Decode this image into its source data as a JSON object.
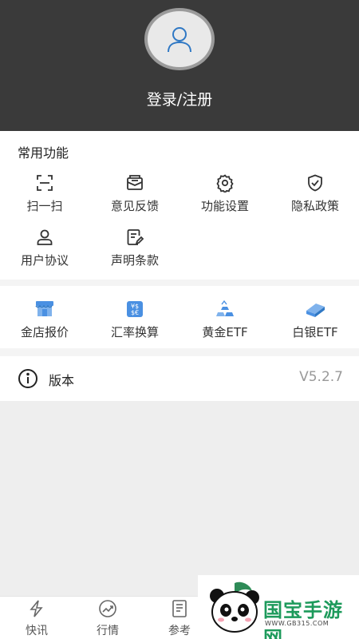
{
  "header": {
    "login_label": "登录/注册"
  },
  "common": {
    "title": "常用功能",
    "items": [
      {
        "label": "扫一扫",
        "icon": "scan-icon"
      },
      {
        "label": "意见反馈",
        "icon": "feedback-icon"
      },
      {
        "label": "功能设置",
        "icon": "gear-icon"
      },
      {
        "label": "隐私政策",
        "icon": "shield-check-icon"
      },
      {
        "label": "用户协议",
        "icon": "user-icon"
      },
      {
        "label": "声明条款",
        "icon": "document-edit-icon"
      }
    ]
  },
  "tools": {
    "items": [
      {
        "label": "金店报价",
        "icon": "gold-store-icon"
      },
      {
        "label": "汇率换算",
        "icon": "exchange-icon"
      },
      {
        "label": "黄金ETF",
        "icon": "gold-bars-icon"
      },
      {
        "label": "白银ETF",
        "icon": "silver-bar-icon"
      }
    ]
  },
  "version": {
    "label": "版本",
    "value": "V5.2.7"
  },
  "tabbar": {
    "items": [
      {
        "label": "快讯",
        "icon": "flash-icon"
      },
      {
        "label": "行情",
        "icon": "trend-icon"
      },
      {
        "label": "参考",
        "icon": "reference-icon"
      }
    ]
  },
  "watermark": {
    "text": "国宝手游网",
    "url": "WWW.GB315.COM"
  },
  "colors": {
    "header_bg": "#3a3a3a",
    "accent": "#4a90e2",
    "watermark_green": "#1d9a5b"
  }
}
